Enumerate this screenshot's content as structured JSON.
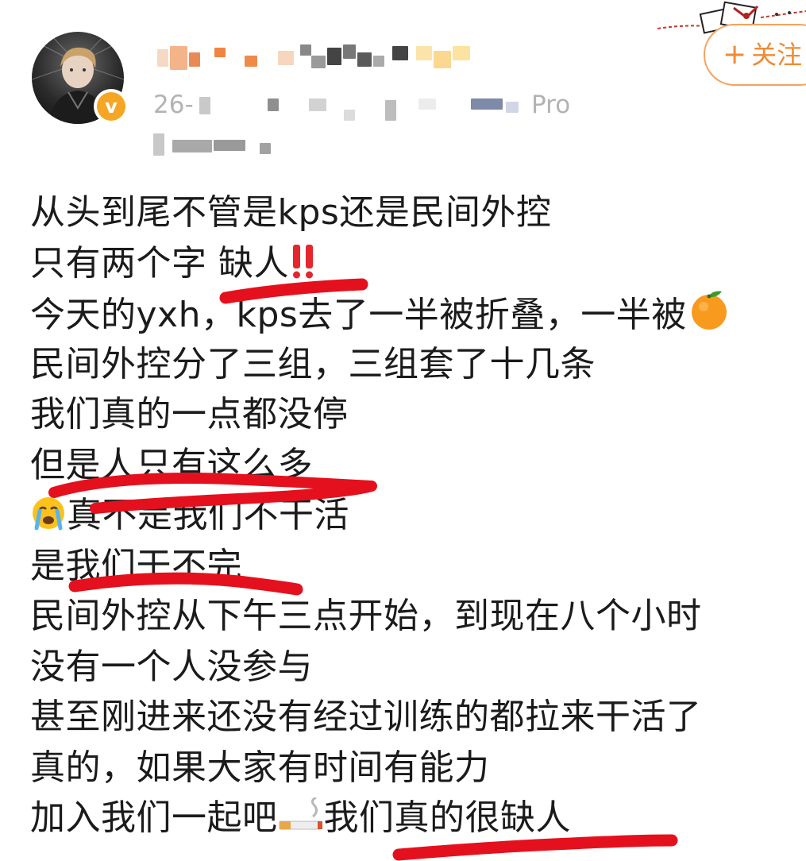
{
  "header": {
    "verified_badge": "v",
    "meta_prefix": "26-",
    "meta_suffix": "Pro",
    "follow_button": {
      "label": "关注",
      "plus": "+"
    }
  },
  "post": {
    "lines": [
      {
        "text": "从头到尾不管是kps还是民间外控",
        "emoji": null
      },
      {
        "text": "只有两个字 缺人",
        "emoji": "double-exclamation-icon"
      },
      {
        "text": "今天的yxh，kps去了一半被折叠，一半被",
        "emoji": "tangerine-icon"
      },
      {
        "text": "民间外控分了三组，三组套了十几条",
        "emoji": null
      },
      {
        "text": "我们真的一点都没停",
        "emoji": null
      },
      {
        "text": "但是人只有这么多",
        "emoji": null
      },
      {
        "text": "真不是我们不干活",
        "emoji": "crying-face-icon",
        "emoji_position": "start"
      },
      {
        "text": "是我们干不完",
        "emoji": null
      },
      {
        "text": "民间外控从下午三点开始，到现在八个小时",
        "emoji": null
      },
      {
        "text": "没有一个人没参与",
        "emoji": null
      },
      {
        "text": "甚至刚进来还没有经过训练的都拉来干活了",
        "emoji": null
      },
      {
        "text": "真的，如果大家有时间有能力",
        "emoji": null
      },
      {
        "text": "加入我们一起吧",
        "emoji": "cigarette-icon",
        "after": "我们真的很缺人"
      }
    ]
  },
  "colors": {
    "underline_red": "#e5101d",
    "follow_orange": "#f08a33",
    "verified_gold": "#f5a623",
    "meta_gray": "#b3b3b3"
  }
}
